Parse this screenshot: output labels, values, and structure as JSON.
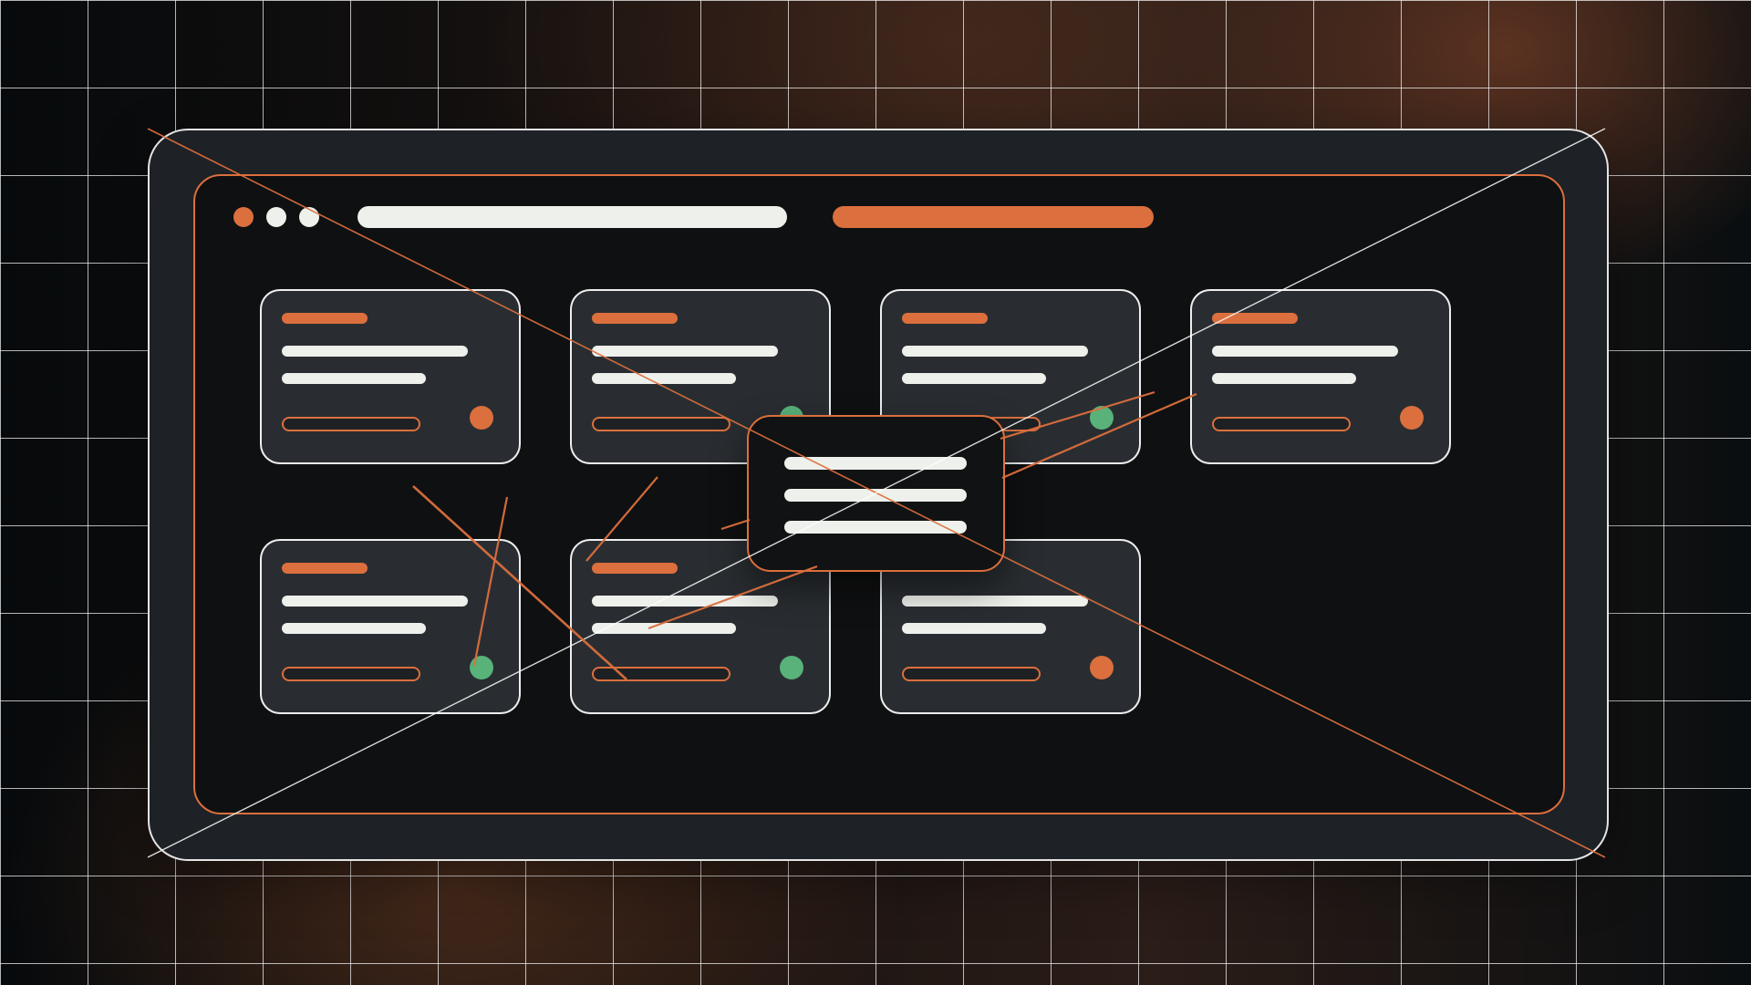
{
  "colors": {
    "background": "#0b1014",
    "frame": "#1e2126",
    "screen": "#0f1011",
    "card": "#292d31",
    "pill": "#eef0ec",
    "accent_orange": "#db6f3d",
    "accent_green": "#58b27a"
  },
  "window_controls": {
    "dots": [
      "orange",
      "white",
      "white"
    ]
  },
  "top_bar": {
    "address_bar": "white-pill",
    "action_bar": "orange-pill"
  },
  "cards": [
    {
      "status_color": "orange"
    },
    {
      "status_color": "green"
    },
    {
      "status_color": "green"
    },
    {
      "status_color": "orange"
    },
    {
      "status_color": "green"
    },
    {
      "status_color": "green"
    },
    {
      "status_color": "orange"
    }
  ],
  "modal": {
    "lines": 3
  },
  "icons": {
    "window_dot": "dot-icon",
    "status_dot": "status-dot-icon"
  }
}
